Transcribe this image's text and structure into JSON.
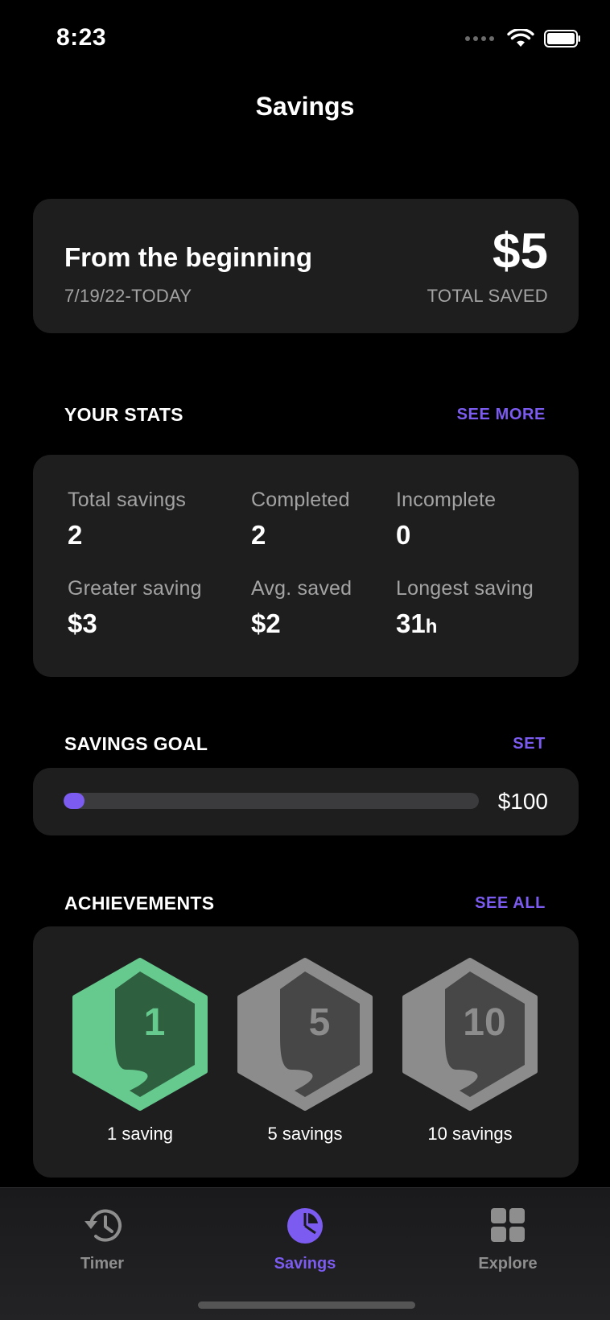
{
  "status_bar": {
    "time": "8:23"
  },
  "nav": {
    "title": "Savings"
  },
  "overview": {
    "title": "From the beginning",
    "date_range": "7/19/22-TODAY",
    "amount": "$5",
    "amount_label": "TOTAL SAVED"
  },
  "stats_section": {
    "title": "YOUR STATS",
    "link": "SEE MORE",
    "items": [
      {
        "label": "Total savings",
        "value": "2",
        "unit": ""
      },
      {
        "label": "Completed",
        "value": "2",
        "unit": ""
      },
      {
        "label": "Incomplete",
        "value": "0",
        "unit": ""
      },
      {
        "label": "Greater saving",
        "value": "$3",
        "unit": ""
      },
      {
        "label": "Avg. saved",
        "value": "$2",
        "unit": ""
      },
      {
        "label": "Longest saving",
        "value": "31",
        "unit": "h"
      }
    ]
  },
  "goal_section": {
    "title": "SAVINGS GOAL",
    "link": "SET",
    "goal_amount": "$100",
    "progress_fraction": 0.05
  },
  "achievements_section": {
    "title": "ACHIEVEMENTS",
    "link": "SEE ALL",
    "badges": [
      {
        "number": "1",
        "caption": "1 saving",
        "unlocked": true
      },
      {
        "number": "5",
        "caption": "5 savings",
        "unlocked": false
      },
      {
        "number": "10",
        "caption": "10 savings",
        "unlocked": false
      }
    ]
  },
  "tabbar": {
    "items": [
      {
        "label": "Timer",
        "icon": "history-icon",
        "active": false
      },
      {
        "label": "Savings",
        "icon": "pie-chart-icon",
        "active": true
      },
      {
        "label": "Explore",
        "icon": "grid-icon",
        "active": false
      }
    ]
  },
  "colors": {
    "accent": "#7c5cf0",
    "card": "#1e1e1f",
    "badge_unlocked_outer": "#66c98d",
    "badge_unlocked_inner": "#2e5f3f",
    "badge_locked_outer": "#8c8c8c",
    "badge_locked_inner": "#474747"
  }
}
